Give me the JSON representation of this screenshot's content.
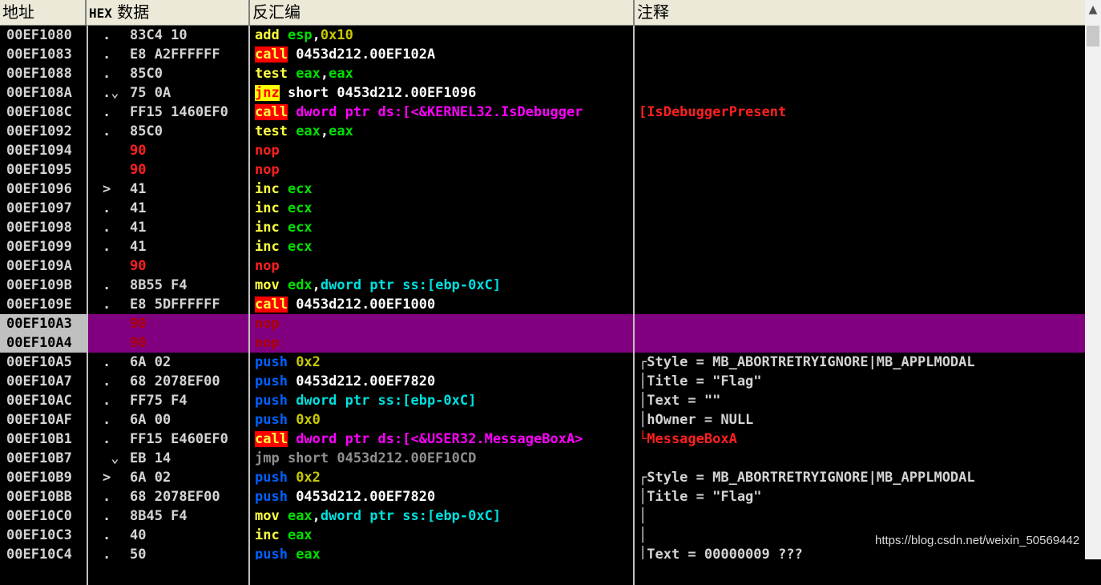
{
  "header": {
    "address": "地址",
    "hex": "HEX",
    "data": "数据",
    "disasm": "反汇编",
    "comment": "注释"
  },
  "rows": [
    {
      "addr": "00EF1080",
      "mark": ".",
      "hex": "83C4 10",
      "dis": [
        {
          "t": "add ",
          "c": "t-yellow"
        },
        {
          "t": "esp",
          "c": "t-green"
        },
        {
          "t": ",",
          "c": "t-white"
        },
        {
          "t": "0x10",
          "c": "t-olive"
        }
      ],
      "cmt": ""
    },
    {
      "addr": "00EF1083",
      "mark": ".",
      "hex": "E8 A2FFFFFF",
      "dis": [
        {
          "t": "call",
          "c": "b-call"
        },
        {
          "t": " 0453d212.00EF102A",
          "c": "t-white"
        }
      ],
      "cmt": ""
    },
    {
      "addr": "00EF1088",
      "mark": ".",
      "hex": "85C0",
      "dis": [
        {
          "t": "test ",
          "c": "t-yellow"
        },
        {
          "t": "eax",
          "c": "t-green"
        },
        {
          "t": ",",
          "c": "t-white"
        },
        {
          "t": "eax",
          "c": "t-green"
        }
      ],
      "cmt": ""
    },
    {
      "addr": "00EF108A",
      "mark": ".⌄",
      "hex": "75 0A",
      "dis": [
        {
          "t": "jnz",
          "c": "b-jcc"
        },
        {
          "t": " short 0453d212.00EF1096",
          "c": "t-white"
        }
      ],
      "cmt": ""
    },
    {
      "addr": "00EF108C",
      "mark": ".",
      "hex": "FF15 1460EF0",
      "dis": [
        {
          "t": "call",
          "c": "b-call"
        },
        {
          "t": " dword ptr ds:[<&KERNEL32.IsDebugger",
          "c": "t-magenta"
        }
      ],
      "cmt": "[IsDebuggerPresent",
      "cmtc": "t-red"
    },
    {
      "addr": "00EF1092",
      "mark": ".",
      "hex": "85C0",
      "dis": [
        {
          "t": "test ",
          "c": "t-yellow"
        },
        {
          "t": "eax",
          "c": "t-green"
        },
        {
          "t": ",",
          "c": "t-white"
        },
        {
          "t": "eax",
          "c": "t-green"
        }
      ],
      "cmt": ""
    },
    {
      "addr": "00EF1094",
      "mark": "",
      "hex": "90",
      "hexc": "t-red",
      "dis": [
        {
          "t": "nop",
          "c": "t-red"
        }
      ],
      "cmt": ""
    },
    {
      "addr": "00EF1095",
      "mark": "",
      "hex": "90",
      "hexc": "t-red",
      "dis": [
        {
          "t": "nop",
          "c": "t-red"
        }
      ],
      "cmt": ""
    },
    {
      "addr": "00EF1096",
      "mark": ">",
      "hex": "41",
      "dis": [
        {
          "t": "inc ",
          "c": "t-yellow"
        },
        {
          "t": "ecx",
          "c": "t-green"
        }
      ],
      "cmt": ""
    },
    {
      "addr": "00EF1097",
      "mark": ".",
      "hex": "41",
      "dis": [
        {
          "t": "inc ",
          "c": "t-yellow"
        },
        {
          "t": "ecx",
          "c": "t-green"
        }
      ],
      "cmt": ""
    },
    {
      "addr": "00EF1098",
      "mark": ".",
      "hex": "41",
      "dis": [
        {
          "t": "inc ",
          "c": "t-yellow"
        },
        {
          "t": "ecx",
          "c": "t-green"
        }
      ],
      "cmt": ""
    },
    {
      "addr": "00EF1099",
      "mark": ".",
      "hex": "41",
      "dis": [
        {
          "t": "inc ",
          "c": "t-yellow"
        },
        {
          "t": "ecx",
          "c": "t-green"
        }
      ],
      "cmt": ""
    },
    {
      "addr": "00EF109A",
      "mark": "",
      "hex": "90",
      "hexc": "t-red",
      "dis": [
        {
          "t": "nop",
          "c": "t-red"
        }
      ],
      "cmt": ""
    },
    {
      "addr": "00EF109B",
      "mark": ".",
      "hex": "8B55 F4",
      "dis": [
        {
          "t": "mov ",
          "c": "t-yellow"
        },
        {
          "t": "edx",
          "c": "t-green"
        },
        {
          "t": ",",
          "c": "t-white"
        },
        {
          "t": "dword ptr ss:[ebp-0xC]",
          "c": "t-cyan"
        }
      ],
      "cmt": ""
    },
    {
      "addr": "00EF109E",
      "mark": ".",
      "hex": "E8 5DFFFFFF",
      "dis": [
        {
          "t": "call",
          "c": "b-call"
        },
        {
          "t": " 0453d212.00EF1000",
          "c": "t-white"
        }
      ],
      "cmt": ""
    },
    {
      "addr": "00EF10A3",
      "mark": "",
      "hex": "90",
      "sel": true,
      "dis": [
        {
          "t": "nop",
          "c": ""
        }
      ],
      "cmt": ""
    },
    {
      "addr": "00EF10A4",
      "mark": "",
      "hex": "90",
      "sel": true,
      "dis": [
        {
          "t": "nop",
          "c": ""
        }
      ],
      "cmt": ""
    },
    {
      "addr": "00EF10A5",
      "mark": ".",
      "hex": "6A 02",
      "dis": [
        {
          "t": "push ",
          "c": "t-blue"
        },
        {
          "t": "0x2",
          "c": "t-olive"
        }
      ],
      "cmt": "┌Style = MB_ABORTRETRYIGNORE|MB_APPLMODAL"
    },
    {
      "addr": "00EF10A7",
      "mark": ".",
      "hex": "68 2078EF00",
      "dis": [
        {
          "t": "push ",
          "c": "t-blue"
        },
        {
          "t": "0453d212.00EF7820",
          "c": "t-white"
        }
      ],
      "cmt": "│Title = \"Flag\""
    },
    {
      "addr": "00EF10AC",
      "mark": ".",
      "hex": "FF75 F4",
      "dis": [
        {
          "t": "push ",
          "c": "t-blue"
        },
        {
          "t": "dword ptr ss:[ebp-0xC]",
          "c": "t-cyan"
        }
      ],
      "cmt": "│Text = \"\""
    },
    {
      "addr": "00EF10AF",
      "mark": ".",
      "hex": "6A 00",
      "dis": [
        {
          "t": "push ",
          "c": "t-blue"
        },
        {
          "t": "0x0",
          "c": "t-olive"
        }
      ],
      "cmt": "│hOwner = NULL"
    },
    {
      "addr": "00EF10B1",
      "mark": ".",
      "hex": "FF15 E460EF0",
      "dis": [
        {
          "t": "call",
          "c": "b-call"
        },
        {
          "t": " dword ptr ds:[<&USER32.MessageBoxA>",
          "c": "t-magenta"
        }
      ],
      "cmt": "└MessageBoxA",
      "cmtc": "t-red"
    },
    {
      "addr": "00EF10B7",
      "mark": " ⌄",
      "hex": "EB 14",
      "dis": [
        {
          "t": "jmp short 0453d212.00EF10CD",
          "c": "t-gray"
        }
      ],
      "cmt": ""
    },
    {
      "addr": "00EF10B9",
      "mark": ">",
      "hex": "6A 02",
      "dis": [
        {
          "t": "push ",
          "c": "t-blue"
        },
        {
          "t": "0x2",
          "c": "t-olive"
        }
      ],
      "cmt": "┌Style = MB_ABORTRETRYIGNORE|MB_APPLMODAL"
    },
    {
      "addr": "00EF10BB",
      "mark": ".",
      "hex": "68 2078EF00",
      "dis": [
        {
          "t": "push ",
          "c": "t-blue"
        },
        {
          "t": "0453d212.00EF7820",
          "c": "t-white"
        }
      ],
      "cmt": "│Title = \"Flag\""
    },
    {
      "addr": "00EF10C0",
      "mark": ".",
      "hex": "8B45 F4",
      "dis": [
        {
          "t": "mov ",
          "c": "t-yellow"
        },
        {
          "t": "eax",
          "c": "t-green"
        },
        {
          "t": ",",
          "c": "t-white"
        },
        {
          "t": "dword ptr ss:[ebp-0xC]",
          "c": "t-cyan"
        }
      ],
      "cmt": "│"
    },
    {
      "addr": "00EF10C3",
      "mark": ".",
      "hex": "40",
      "dis": [
        {
          "t": "inc ",
          "c": "t-yellow"
        },
        {
          "t": "eax",
          "c": "t-green"
        }
      ],
      "cmt": "│"
    },
    {
      "addr": "00EF10C4",
      "mark": ".",
      "hex": "50",
      "dis": [
        {
          "t": "push ",
          "c": "t-blue"
        },
        {
          "t": "eax",
          "c": "t-green"
        }
      ],
      "cmt": "│Text = 00000009 ???"
    }
  ],
  "scroll": {
    "up_icon": "▲"
  },
  "watermark": "https://blog.csdn.net/weixin_50569442"
}
